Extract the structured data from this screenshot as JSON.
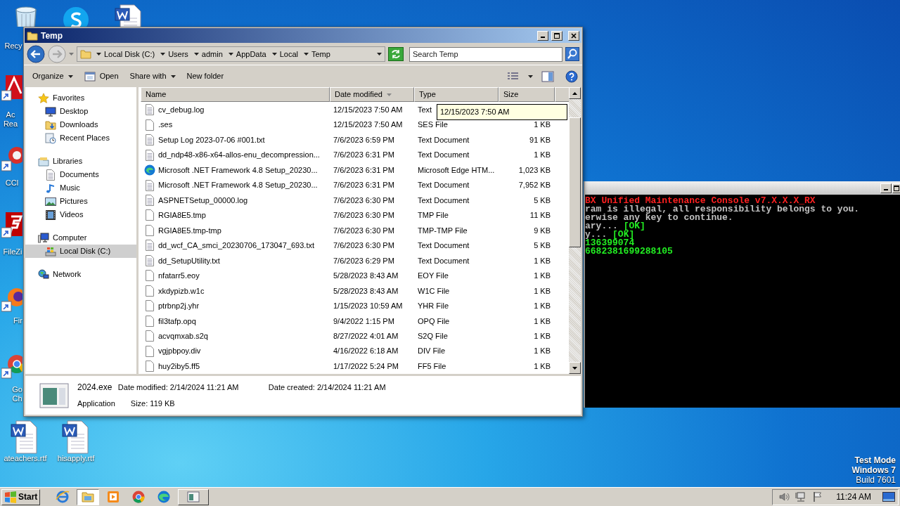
{
  "desktop": {
    "icons": [
      {
        "label": "Recy",
        "kind": "trash"
      },
      {
        "kind": "chat"
      },
      {
        "kind": "word"
      },
      {
        "label": "Ac Rea",
        "kind": "pdf"
      },
      {
        "label": "CCl",
        "kind": "cleaner"
      },
      {
        "label": "FileZi",
        "kind": "ftp"
      },
      {
        "label": "Fir",
        "kind": "firefox"
      },
      {
        "label": "Go Ch",
        "kind": "chrome"
      },
      {
        "label": "ateachers.rtf",
        "kind": "word"
      },
      {
        "label": "hisapply.rtf",
        "kind": "word"
      }
    ],
    "notice": [
      {
        "text": "Test Mode",
        "bold": true
      },
      {
        "text": "Windows 7",
        "bold": true
      },
      {
        "text": "Build 7601",
        "bold": false
      }
    ]
  },
  "console": {
    "lines": [
      {
        "segments": [
          {
            "text": "BX Unified Maintenance Console v7.X.X.X_RX",
            "kind": "title"
          }
        ]
      },
      {
        "segments": [
          {
            "text": "ram is illegal, all responsibility belongs to you.",
            "kind": "text"
          }
        ]
      },
      {
        "segments": [
          {
            "text": "erwise any key to continue.",
            "kind": "text"
          }
        ]
      },
      {
        "segments": [
          {
            "text": "ary...",
            "kind": "text"
          },
          {
            "text": "[OK]",
            "kind": "ok"
          }
        ]
      },
      {
        "segments": [
          {
            "text": "y...",
            "kind": "text"
          },
          {
            "text": "[OK]",
            "kind": "ok"
          }
        ]
      },
      {
        "segments": [
          {
            "text": "136399074",
            "kind": "ok"
          }
        ]
      },
      {
        "segments": [
          {
            "text": "6682381699288105",
            "kind": "ok"
          }
        ]
      }
    ]
  },
  "explorer": {
    "title": "Temp",
    "breadcrumb": [
      "Local Disk (C:)",
      "Users",
      "admin",
      "AppData",
      "Local",
      "Temp"
    ],
    "search": {
      "placeholder": "Search Temp"
    },
    "toolbar": [
      {
        "label": "Organize",
        "kind": "menu"
      },
      {
        "label": "Open",
        "kind": "icon"
      },
      {
        "label": "Share with",
        "kind": "menu"
      },
      {
        "label": "New folder",
        "kind": "plain"
      }
    ],
    "nav": [
      {
        "label": "Favorites",
        "kind": "star",
        "selected": false,
        "children": [
          {
            "label": "Desktop",
            "kind": "desktop",
            "selected": false
          },
          {
            "label": "Downloads",
            "kind": "downloads",
            "selected": false
          },
          {
            "label": "Recent Places",
            "kind": "recent",
            "selected": false
          }
        ]
      },
      {
        "label": "Libraries",
        "kind": "library",
        "selected": false,
        "children": [
          {
            "label": "Documents",
            "kind": "doc",
            "selected": false
          },
          {
            "label": "Music",
            "kind": "music",
            "selected": false
          },
          {
            "label": "Pictures",
            "kind": "pictures",
            "selected": false
          },
          {
            "label": "Videos",
            "kind": "videos",
            "selected": false
          }
        ]
      },
      {
        "label": "Computer",
        "kind": "computer",
        "selected": false,
        "children": [
          {
            "label": "Local Disk (C:)",
            "kind": "disk",
            "selected": true
          }
        ]
      },
      {
        "label": "Network",
        "kind": "network",
        "selected": false
      }
    ],
    "columns": [
      {
        "label": "Name",
        "sorted": false
      },
      {
        "label": "Date modified",
        "sorted": true
      },
      {
        "label": "Type",
        "sorted": false
      },
      {
        "label": "Size",
        "sorted": false
      }
    ],
    "rows": [
      {
        "name": "cv_debug.log",
        "date": "12/15/2023 7:50 AM",
        "type": "Text",
        "kind": "text"
      },
      {
        "name": ".ses",
        "date": "12/15/2023 7:50 AM",
        "type": "SES File",
        "size": "1 KB",
        "kind": "blank"
      },
      {
        "name": "Setup Log 2023-07-06 #001.txt",
        "date": "7/6/2023 6:59 PM",
        "type": "Text Document",
        "size": "91 KB",
        "kind": "text"
      },
      {
        "name": "dd_ndp48-x86-x64-allos-enu_decompression...",
        "date": "7/6/2023 6:31 PM",
        "type": "Text Document",
        "size": "1 KB",
        "kind": "text"
      },
      {
        "name": "Microsoft .NET Framework 4.8 Setup_20230...",
        "date": "7/6/2023 6:31 PM",
        "type": "Microsoft Edge HTM...",
        "size": "1,023 KB",
        "kind": "edge"
      },
      {
        "name": "Microsoft .NET Framework 4.8 Setup_20230...",
        "date": "7/6/2023 6:31 PM",
        "type": "Text Document",
        "size": "7,952 KB",
        "kind": "text"
      },
      {
        "name": "ASPNETSetup_00000.log",
        "date": "7/6/2023 6:30 PM",
        "type": "Text Document",
        "size": "5 KB",
        "kind": "text"
      },
      {
        "name": "RGIA8E5.tmp",
        "date": "7/6/2023 6:30 PM",
        "type": "TMP File",
        "size": "11 KB",
        "kind": "blank"
      },
      {
        "name": "RGIA8E5.tmp-tmp",
        "date": "7/6/2023 6:30 PM",
        "type": "TMP-TMP File",
        "size": "9 KB",
        "kind": "blank"
      },
      {
        "name": "dd_wcf_CA_smci_20230706_173047_693.txt",
        "date": "7/6/2023 6:30 PM",
        "type": "Text Document",
        "size": "5 KB",
        "kind": "text"
      },
      {
        "name": "dd_SetupUtility.txt",
        "date": "7/6/2023 6:29 PM",
        "type": "Text Document",
        "size": "1 KB",
        "kind": "text"
      },
      {
        "name": "nfatarr5.eoy",
        "date": "5/28/2023 8:43 AM",
        "type": "EOY File",
        "size": "1 KB",
        "kind": "blank"
      },
      {
        "name": "xkdypizb.w1c",
        "date": "5/28/2023 8:43 AM",
        "type": "W1C File",
        "size": "1 KB",
        "kind": "blank"
      },
      {
        "name": "ptrbnp2j.yhr",
        "date": "1/15/2023 10:59 AM",
        "type": "YHR File",
        "size": "1 KB",
        "kind": "blank"
      },
      {
        "name": "fil3tafp.opq",
        "date": "9/4/2022 1:15 PM",
        "type": "OPQ File",
        "size": "1 KB",
        "kind": "blank"
      },
      {
        "name": "acvqmxab.s2q",
        "date": "8/27/2022 4:01 AM",
        "type": "S2Q File",
        "size": "1 KB",
        "kind": "blank"
      },
      {
        "name": "vgjpbpoy.div",
        "date": "4/16/2022 6:18 AM",
        "type": "DIV File",
        "size": "1 KB",
        "kind": "blank"
      },
      {
        "name": "huy2iby5.ff5",
        "date": "1/17/2022 5:24 PM",
        "type": "FF5 File",
        "size": "1 KB",
        "kind": "blank"
      }
    ],
    "tooltip": "12/15/2023 7:50 AM",
    "details": {
      "name": "2024.exe",
      "modified": "Date modified: 2/14/2024 11:21 AM",
      "created": "Date created: 2/14/2024 11:21 AM",
      "type": "Application",
      "size": "Size: 119 KB"
    }
  },
  "taskbar": {
    "start": "Start",
    "apps": [
      {
        "kind": "ie",
        "selected": false
      },
      {
        "kind": "folder",
        "selected": true
      },
      {
        "kind": "media",
        "selected": false
      },
      {
        "kind": "chrome",
        "selected": false
      },
      {
        "kind": "edge",
        "selected": false
      },
      {
        "kind": "window",
        "selected": false
      }
    ],
    "clock": "11:24 AM"
  }
}
